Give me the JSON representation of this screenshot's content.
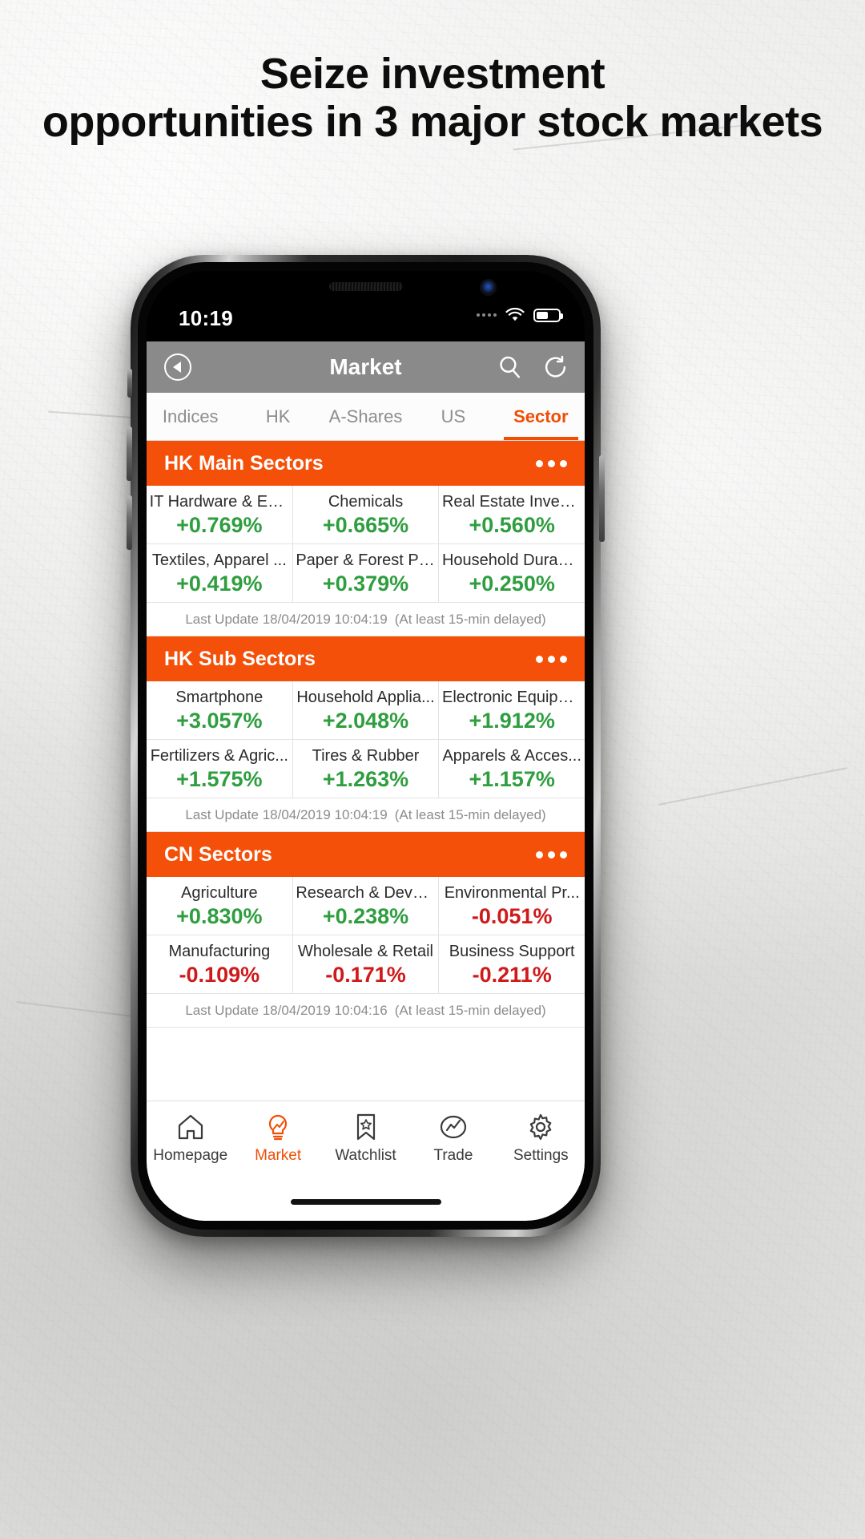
{
  "headline": {
    "line1": "Seize investment",
    "line2": "opportunities in 3 major stock markets"
  },
  "status_bar": {
    "time": "10:19",
    "wifi_icon": "wifi-icon",
    "battery_icon": "battery-icon",
    "battery_level_pct": 55
  },
  "nav_bar": {
    "back_icon": "back-arrow-icon",
    "title": "Market",
    "search_icon": "search-icon",
    "refresh_icon": "refresh-icon"
  },
  "market_tabs": {
    "items": [
      {
        "label": "Indices",
        "active": false
      },
      {
        "label": "HK",
        "active": false
      },
      {
        "label": "A-Shares",
        "active": false
      },
      {
        "label": "US",
        "active": false
      },
      {
        "label": "Sector",
        "active": true
      }
    ],
    "active_color": "#f04e06"
  },
  "sections": [
    {
      "title": "HK Main Sectors",
      "more_icon": "more-dots-icon",
      "cells": [
        {
          "name": "IT Hardware & Eq...",
          "change": "+0.769%",
          "dir": "up"
        },
        {
          "name": "Chemicals",
          "change": "+0.665%",
          "dir": "up"
        },
        {
          "name": "Real Estate Invest...",
          "change": "+0.560%",
          "dir": "up"
        },
        {
          "name": "Textiles, Apparel ...",
          "change": "+0.419%",
          "dir": "up"
        },
        {
          "name": "Paper & Forest Pr...",
          "change": "+0.379%",
          "dir": "up"
        },
        {
          "name": "Household Durabl...",
          "change": "+0.250%",
          "dir": "up"
        }
      ],
      "last_update": "Last Update 18/04/2019 10:04:19",
      "delay_note": "(At least 15-min delayed)"
    },
    {
      "title": "HK Sub Sectors",
      "more_icon": "more-dots-icon",
      "cells": [
        {
          "name": "Smartphone",
          "change": "+3.057%",
          "dir": "up"
        },
        {
          "name": "Household Applia...",
          "change": "+2.048%",
          "dir": "up"
        },
        {
          "name": "Electronic Equipm...",
          "change": "+1.912%",
          "dir": "up"
        },
        {
          "name": "Fertilizers & Agric...",
          "change": "+1.575%",
          "dir": "up"
        },
        {
          "name": "Tires & Rubber",
          "change": "+1.263%",
          "dir": "up"
        },
        {
          "name": "Apparels & Acces...",
          "change": "+1.157%",
          "dir": "up"
        }
      ],
      "last_update": "Last Update 18/04/2019 10:04:19",
      "delay_note": "(At least 15-min delayed)"
    },
    {
      "title": "CN Sectors",
      "more_icon": "more-dots-icon",
      "cells": [
        {
          "name": "Agriculture",
          "change": "+0.830%",
          "dir": "up"
        },
        {
          "name": "Research & Devel...",
          "change": "+0.238%",
          "dir": "up"
        },
        {
          "name": "Environmental Pr...",
          "change": "-0.051%",
          "dir": "down"
        },
        {
          "name": "Manufacturing",
          "change": "-0.109%",
          "dir": "down"
        },
        {
          "name": "Wholesale & Retail",
          "change": "-0.171%",
          "dir": "down"
        },
        {
          "name": "Business Support",
          "change": "-0.211%",
          "dir": "down"
        }
      ],
      "last_update": "Last Update 18/04/2019 10:04:16",
      "delay_note": "(At least 15-min delayed)"
    }
  ],
  "bottom_tabs": {
    "items": [
      {
        "label": "Homepage",
        "icon": "home-icon",
        "active": false
      },
      {
        "label": "Market",
        "icon": "bulb-chart-icon",
        "active": true
      },
      {
        "label": "Watchlist",
        "icon": "bookmark-star-icon",
        "active": false
      },
      {
        "label": "Trade",
        "icon": "trend-line-icon",
        "active": false
      },
      {
        "label": "Settings",
        "icon": "gear-icon",
        "active": false
      }
    ]
  },
  "colors": {
    "brand_orange": "#f4500a",
    "up_green": "#2f9e3f",
    "down_red": "#cf1a1a",
    "navbar_grey": "#8a8a8a"
  }
}
